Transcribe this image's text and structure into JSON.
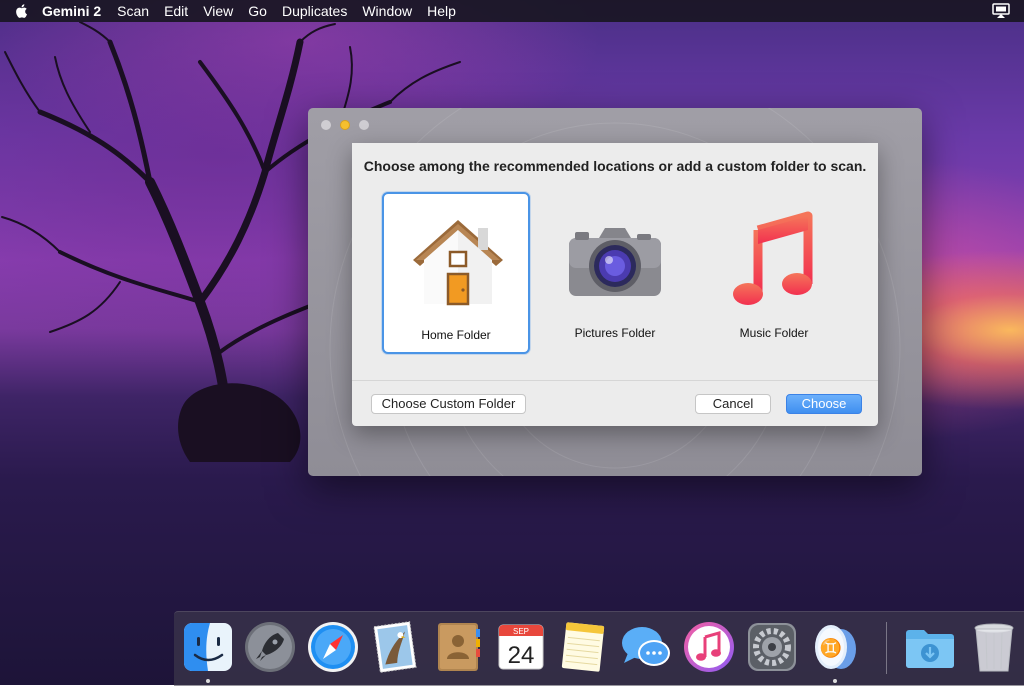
{
  "menubar": {
    "app_name": "Gemini 2",
    "menus": [
      "Scan",
      "Edit",
      "View",
      "Go",
      "Duplicates",
      "Window",
      "Help"
    ]
  },
  "dialog": {
    "title": "Choose among the recommended locations or add a custom folder to scan.",
    "locations": [
      {
        "label": "Home Folder",
        "icon": "house-icon",
        "selected": true
      },
      {
        "label": "Pictures Folder",
        "icon": "camera-icon",
        "selected": false
      },
      {
        "label": "Music Folder",
        "icon": "music-note-icon",
        "selected": false
      }
    ],
    "buttons": {
      "custom": "Choose Custom Folder",
      "cancel": "Cancel",
      "choose": "Choose"
    }
  },
  "dock": {
    "calendar_month": "SEP",
    "calendar_day": "24",
    "items": [
      "finder-icon",
      "launchpad-icon",
      "safari-icon",
      "mail-icon",
      "contacts-icon",
      "calendar-icon",
      "notes-icon",
      "messages-icon",
      "itunes-icon",
      "system-preferences-icon",
      "gemini-icon",
      "downloads-folder-icon",
      "trash-icon"
    ]
  },
  "colors": {
    "accent": "#3f8ff0",
    "selection_border": "#4a94e6",
    "minimize": "#f5bf2f"
  }
}
